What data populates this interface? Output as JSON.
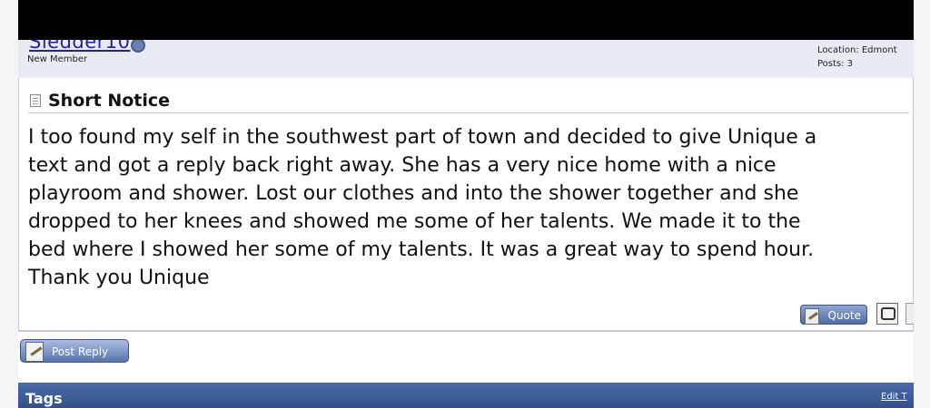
{
  "post": {
    "username": "Sledder10",
    "rank": "New Member",
    "location": "Location: Edmont",
    "posts": "Posts: 3",
    "title": "Short Notice",
    "message": "I too found my self in the southwest part of town and decided to give Unique a\ntext and got a reply back right away. She has a very nice home with a nice\nplayroom and shower. Lost our clothes and into the shower together and she\ndropped to her knees and showed me some of her talents. We made it to the\nbed where I showed her some of my talents. It was a great way to spend hour.\nThank you Unique"
  },
  "buttons": {
    "quote": "Quote",
    "post_reply": "Post Reply"
  },
  "tags": {
    "title": "Tags",
    "edit": "Edit T"
  }
}
